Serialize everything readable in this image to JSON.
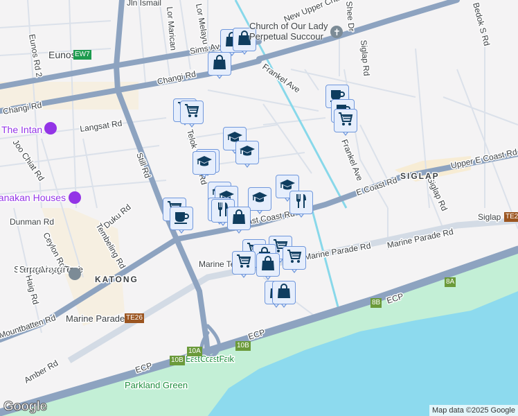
{
  "colors": {
    "road_major": "#8da3c0",
    "road_minor": "#d3dbe5",
    "sea": "#8ddaee",
    "park": "#c3efd6",
    "land": "#f4f3f4",
    "marker_fill": "#e6eefc",
    "marker_border": "#6f97dc",
    "icon": "#0f3d5f"
  },
  "roads": {
    "still": "Still Rd",
    "changi_upper": "Changi Rd",
    "changi_lower": "Changi Rd",
    "sims": "Sims Ave",
    "new_upper_changi": "New Upper Changi Rd",
    "frankel1": "Frankel Ave",
    "frankel2": "Frankel Ave",
    "siglap": "Siglap Rd",
    "siglap2": "Siglap Rd",
    "bedok_s": "Bedok S Rd",
    "upper_e_coast": "Upper E Coast Rd",
    "e_coast": "E Coast Rd",
    "e_coast2": "East Coast Rd",
    "marine_parade": "Marine Parade Rd",
    "marine_parade2": "Marine Parade Rd",
    "marine_t": "Marine Terrace",
    "langsat": "Langsat Rd",
    "joo_chiat": "Joo Chiat Rd",
    "eunos2": "Eunos Rd 2",
    "dunman": "Dunman Rd",
    "duku": "Duku Rd",
    "tembeling": "Tembeling Rd",
    "ceylon": "Ceylon Rd",
    "haig": "Haig Rd",
    "mountbatten": "Mountbatten Rd",
    "amber": "Amber Rd",
    "ecp1": "ECP",
    "ecp2": "ECP",
    "ecp3": "ECP",
    "jln_ismail": "Jln Ismail",
    "lor_marican": "Lor Marican",
    "lor_melayu": "Lor Melayu",
    "telok": "Telok Kurau Rd",
    "shee": "Shee Dr"
  },
  "places": {
    "eunos": "Eunos",
    "eunos_code": "EW7",
    "intan": "The Intan",
    "peranakan": "Peranakan Houses",
    "church": "Church of Our Lady Perpetual Succour",
    "temple": "Sri Senpaga Vinayagar Temple",
    "katong": "KATONG",
    "siglap_area": "SIGLAP",
    "marine_parade": "Marine Parade",
    "marine_parade_code": "TE26",
    "siglap_stn": "Siglap",
    "siglap_code": "TE27",
    "ecp_park": "East Coast Park",
    "parkland": "Parkland Green"
  },
  "exits": [
    "10A",
    "10B",
    "10B",
    "8B",
    "8A"
  ],
  "markers": [
    {
      "type": "bag"
    },
    {
      "type": "bag"
    },
    {
      "type": "bag"
    },
    {
      "type": "cart"
    },
    {
      "type": "cart"
    },
    {
      "type": "cap"
    },
    {
      "type": "cap"
    },
    {
      "type": "cap"
    },
    {
      "type": "cap"
    },
    {
      "type": "cap"
    },
    {
      "type": "cap"
    },
    {
      "type": "cap"
    },
    {
      "type": "cap"
    },
    {
      "type": "food"
    },
    {
      "type": "food"
    },
    {
      "type": "food"
    },
    {
      "type": "bag"
    },
    {
      "type": "cart"
    },
    {
      "type": "coffee"
    },
    {
      "type": "coffee"
    },
    {
      "type": "coffee"
    },
    {
      "type": "cart"
    },
    {
      "type": "cart"
    },
    {
      "type": "cart"
    },
    {
      "type": "cart"
    },
    {
      "type": "bag"
    },
    {
      "type": "cart"
    },
    {
      "type": "bag"
    },
    {
      "type": "bag"
    },
    {
      "type": "bag"
    }
  ],
  "attribution": "Map data ©2025 Google",
  "logo": "Google"
}
